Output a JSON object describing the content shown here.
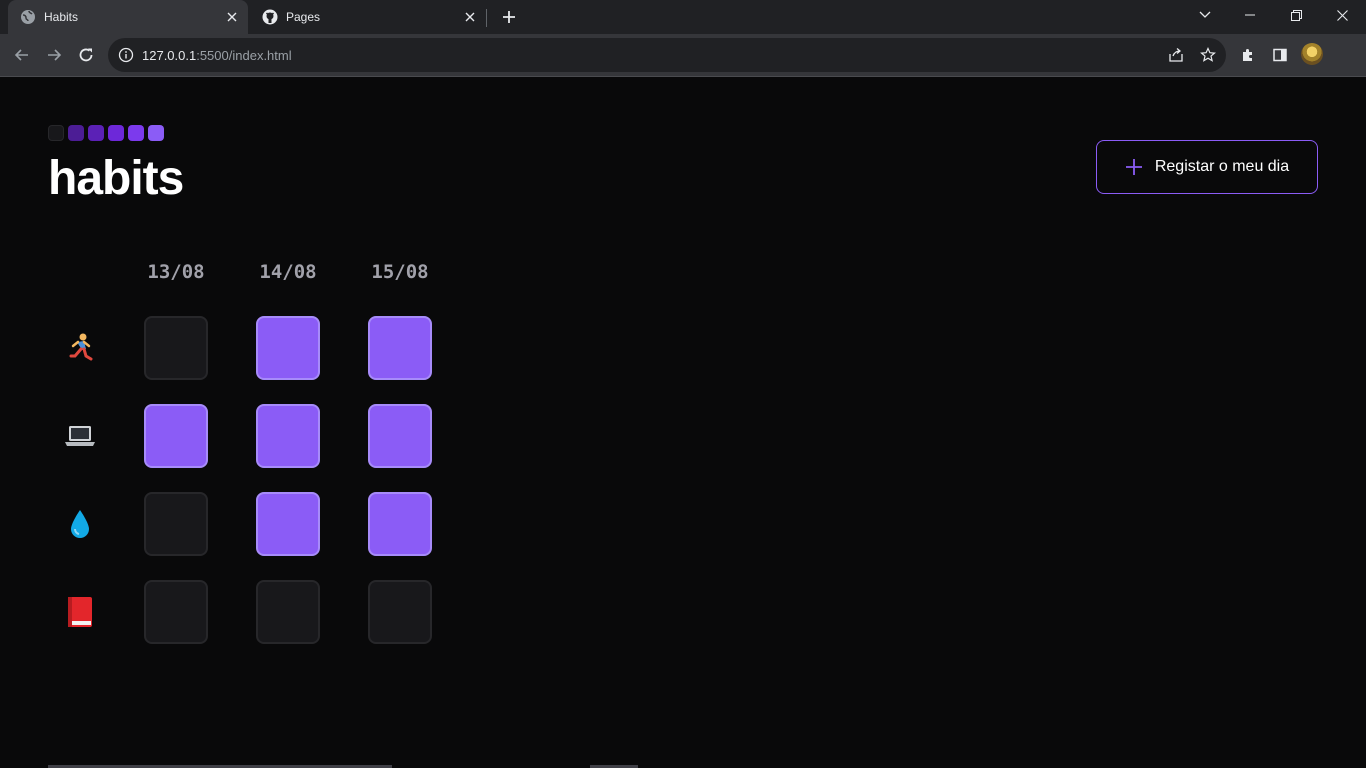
{
  "browser": {
    "tabs": [
      {
        "label": "Habits",
        "icon": "globe-icon"
      },
      {
        "label": "Pages",
        "icon": "github-icon"
      }
    ],
    "url_host": "127.0.0.1",
    "url_rest": ":5500/index.html"
  },
  "app": {
    "title": "habits",
    "register_label": "Registar o meu dia",
    "logo_colors": [
      "#18181b",
      "#4c1d95",
      "#5b21b6",
      "#6d28d9",
      "#7c3aed",
      "#8b5cf6"
    ],
    "accent": "#8b5cf6"
  },
  "grid": {
    "dates": [
      "13/08",
      "14/08",
      "15/08"
    ],
    "habits": [
      {
        "name": "running",
        "emoji": "🏃",
        "checked": [
          false,
          true,
          true
        ]
      },
      {
        "name": "laptop",
        "emoji": "💻",
        "checked": [
          true,
          true,
          true
        ]
      },
      {
        "name": "water",
        "emoji": "💧",
        "checked": [
          false,
          true,
          true
        ]
      },
      {
        "name": "book",
        "emoji": "📕",
        "checked": [
          false,
          false,
          false
        ]
      }
    ]
  }
}
